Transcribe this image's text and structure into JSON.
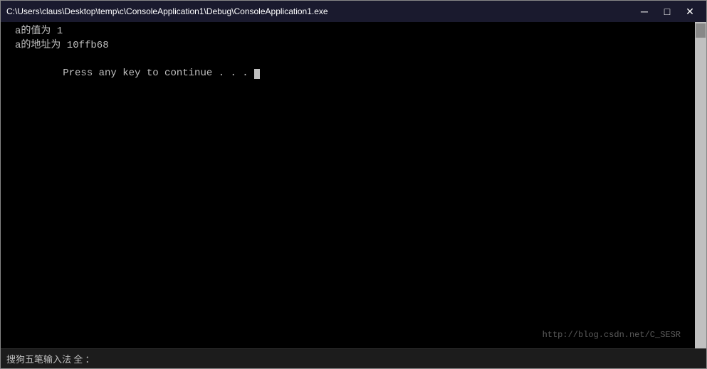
{
  "titleBar": {
    "title": "C:\\Users\\claus\\Desktop\\temp\\c\\ConsoleApplication1\\Debug\\ConsoleApplication1.exe",
    "minimizeLabel": "─",
    "maximizeLabel": "□",
    "closeLabel": "✕"
  },
  "console": {
    "lines": [
      "a的值为 1",
      "a的地址为 10ffb68",
      "Press any key to continue . . . "
    ]
  },
  "bottomBar": {
    "inputMethod": "搜狗五笔输入法  全  ：",
    "watermark": "http://blog.csdn.net/C_SESR"
  }
}
